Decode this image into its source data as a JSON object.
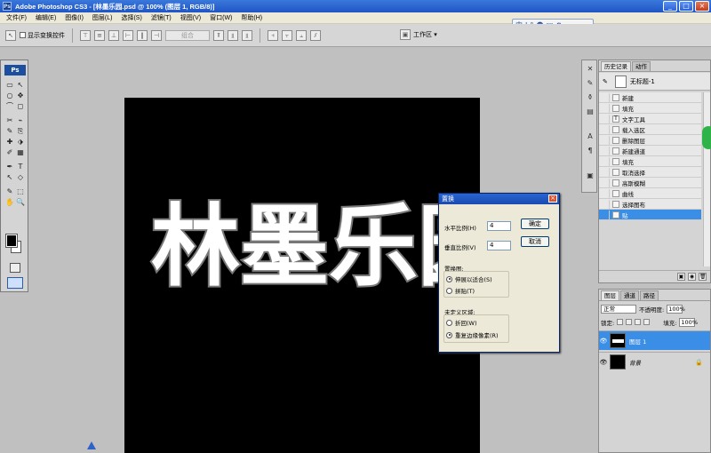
{
  "titlebar": {
    "app_icon": "Ps",
    "title": "Adobe Photoshop CS3 - [林墨乐园.psd @ 100% (图层 1, RGB/8)]",
    "min": "_",
    "max": "□",
    "close": "×"
  },
  "menu": [
    "文件(F)",
    "编辑(E)",
    "图像(I)",
    "图层(L)",
    "选择(S)",
    "滤镜(T)",
    "视图(V)",
    "窗口(W)",
    "帮助(H)"
  ],
  "ime": {
    "label": "中",
    "items": [
      "J",
      "°",
      "☻",
      "▣",
      "⚙"
    ]
  },
  "options": {
    "show_bounds": "显示变换控件",
    "combine": "组合",
    "workspace": "工作区 ▾"
  },
  "tools": {
    "badge": "Ps",
    "glyphs": [
      "▭",
      "↖",
      "○",
      "✥",
      "⌒",
      "◻",
      "✂",
      "⌁",
      "✎",
      "⎘",
      "✚",
      "⬗",
      "✐",
      "▦",
      "◐",
      "▲",
      "⬮",
      "✋",
      "✒",
      "T",
      "↖",
      "◇",
      "✎",
      "⬚",
      "✋",
      "🔍"
    ]
  },
  "canvas": {
    "text": "林墨乐园"
  },
  "dialog": {
    "title": "置换",
    "h_scale_label": "水平比例(H)",
    "h_scale_value": "4",
    "v_scale_label": "垂直比例(V)",
    "v_scale_value": "4",
    "ok": "确定",
    "cancel": "取消",
    "map_group": "置换图:",
    "map_opt1": "伸展以适合(S)",
    "map_opt2": "拼贴(T)",
    "undef_group": "未定义区域:",
    "undef_opt1": "折回(W)",
    "undef_opt2": "重复边缘像素(R)"
  },
  "history": {
    "tab_history": "历史记录",
    "tab_actions": "动作",
    "snapshot": "无标题-1",
    "items": [
      "新建",
      "填充",
      "文字工具",
      "载入选区",
      "删除图层",
      "新建通道",
      "填充",
      "取消选择",
      "高斯模糊",
      "曲线",
      "选择图布",
      "贴"
    ],
    "selected_index": 11
  },
  "layers": {
    "tab_layers": "图层",
    "tab_channels": "通道",
    "tab_paths": "路径",
    "blend_mode": "正常",
    "opacity_label": "不透明度:",
    "opacity": "100%",
    "lock_label": "锁定:",
    "fill_label": "填充:",
    "fill": "100%",
    "items": [
      {
        "name": "图层 1",
        "selected": true
      },
      {
        "name": "背景",
        "selected": false,
        "locked": true
      }
    ],
    "lock_glyph": "🔒",
    "eye_glyph": "👁"
  }
}
